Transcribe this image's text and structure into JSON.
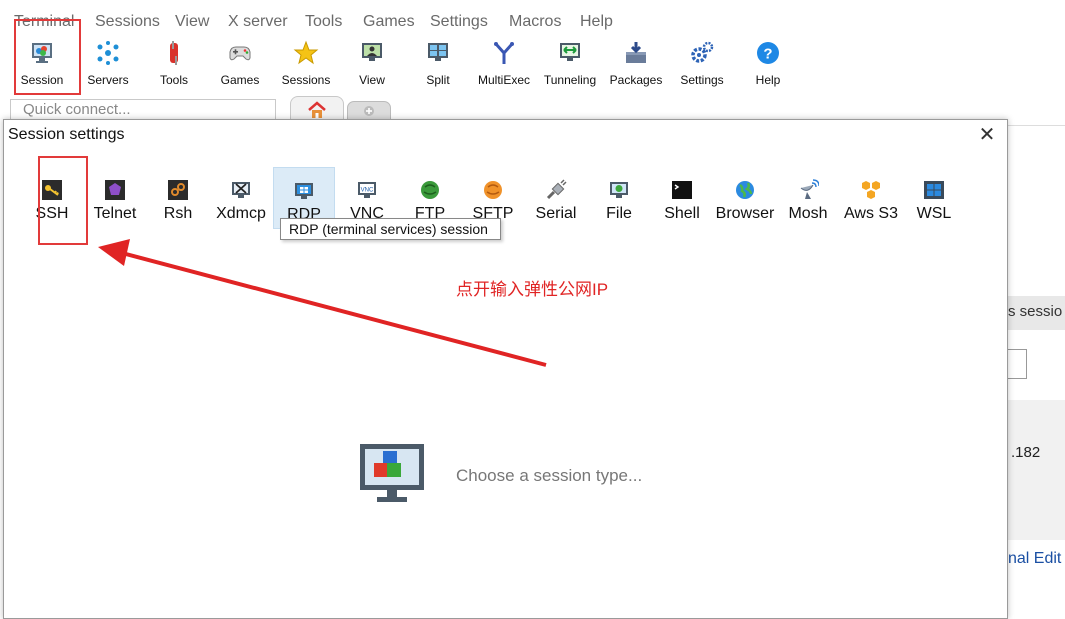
{
  "menubar": {
    "items": [
      "Terminal",
      "Sessions",
      "View",
      "X server",
      "Tools",
      "Games",
      "Settings",
      "Macros",
      "Help"
    ]
  },
  "toolbar": {
    "items": [
      {
        "label": "Session",
        "icon": "session-icon"
      },
      {
        "label": "Servers",
        "icon": "servers-icon"
      },
      {
        "label": "Tools",
        "icon": "tools-icon"
      },
      {
        "label": "Games",
        "icon": "games-icon"
      },
      {
        "label": "Sessions",
        "icon": "star-icon"
      },
      {
        "label": "View",
        "icon": "view-icon"
      },
      {
        "label": "Split",
        "icon": "split-icon"
      },
      {
        "label": "MultiExec",
        "icon": "multiexec-icon"
      },
      {
        "label": "Tunneling",
        "icon": "tunneling-icon"
      },
      {
        "label": "Packages",
        "icon": "packages-icon"
      },
      {
        "label": "Settings",
        "icon": "gear-icon"
      },
      {
        "label": "Help",
        "icon": "help-icon"
      }
    ]
  },
  "quick_connect": {
    "placeholder": "Quick connect..."
  },
  "background": {
    "session_button_fragment": "s sessio",
    "ip_fragment": ".182",
    "editor_fragment": "nal Edit"
  },
  "dialog": {
    "title": "Session settings",
    "close": "✕",
    "session_types": [
      {
        "label": "SSH",
        "icon": "key-icon"
      },
      {
        "label": "Telnet",
        "icon": "telnet-icon"
      },
      {
        "label": "Rsh",
        "icon": "rsh-icon"
      },
      {
        "label": "Xdmcp",
        "icon": "xdmcp-icon"
      },
      {
        "label": "RDP",
        "icon": "rdp-icon"
      },
      {
        "label": "VNC",
        "icon": "vnc-icon"
      },
      {
        "label": "FTP",
        "icon": "ftp-icon"
      },
      {
        "label": "SFTP",
        "icon": "sftp-icon"
      },
      {
        "label": "Serial",
        "icon": "serial-icon"
      },
      {
        "label": "File",
        "icon": "file-icon"
      },
      {
        "label": "Shell",
        "icon": "shell-icon"
      },
      {
        "label": "Browser",
        "icon": "globe-icon"
      },
      {
        "label": "Mosh",
        "icon": "mosh-icon"
      },
      {
        "label": "Aws S3",
        "icon": "aws-icon"
      },
      {
        "label": "WSL",
        "icon": "windows-icon"
      }
    ],
    "tooltip": "RDP (terminal services) session",
    "annotation": "点开输入弹性公网IP",
    "choose_text": "Choose a session type..."
  },
  "colors": {
    "highlight": "#e23a3a",
    "annotation": "#e02424",
    "selected_bg": "#dcebf7"
  }
}
